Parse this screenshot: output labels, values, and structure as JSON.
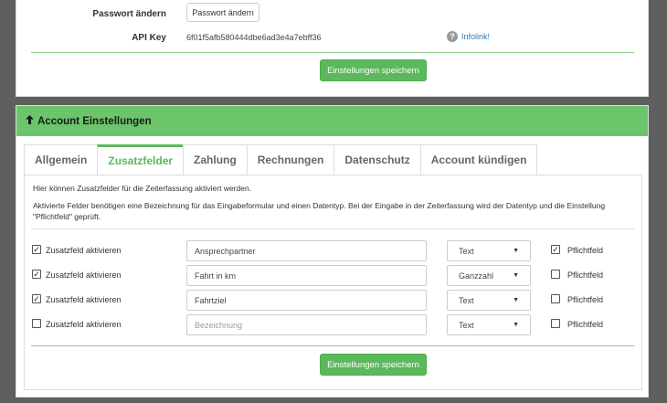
{
  "top_panel": {
    "password_label": "Passwort ändern",
    "password_button": "Passwort ändern",
    "api_key_label": "API Key",
    "api_key_value": "6f01f5afb580444dbe6ad3e4a7ebff36",
    "infolink_label": "Infolink!",
    "question_glyph": "?",
    "save_button": "Einstellungen speichern"
  },
  "account_panel": {
    "heading": "Account Einstellungen",
    "heading_icon_glyph": "🠙",
    "tabs": [
      {
        "label": "Allgemein",
        "active": false
      },
      {
        "label": "Zusatzfelder",
        "active": true
      },
      {
        "label": "Zahlung",
        "active": false
      },
      {
        "label": "Rechnungen",
        "active": false
      },
      {
        "label": "Datenschutz",
        "active": false
      },
      {
        "label": "Account kündigen",
        "active": false
      }
    ],
    "intro_text": "Hier können Zusatzfelder für die Zeiterfassung aktiviert werden.",
    "help_text": "Aktivierte Felder benötigen eine Bezeichnung für das Eingabeformular und einen Datentyp. Bei der Eingabe in der Zeiterfassung wird der Datentyp und die Einstellung \"Pflichtfeld\" geprüft.",
    "activate_label": "Zusatzfeld aktivieren",
    "required_label": "Pflichtfeld",
    "placeholder": "Bezeichnung",
    "caret_glyph": "▼",
    "check_glyph": "✓",
    "fields": [
      {
        "active": true,
        "name": "Ansprechpartner",
        "type": "Text",
        "required": true
      },
      {
        "active": true,
        "name": "Fahrt in km",
        "type": "Ganzzahl",
        "required": false
      },
      {
        "active": true,
        "name": "Fahrtziel",
        "type": "Text",
        "required": false
      },
      {
        "active": false,
        "name": "",
        "type": "Text",
        "required": false
      }
    ],
    "save_button": "Einstellungen speichern"
  },
  "colors": {
    "heading_green": "#6cc56b",
    "button_green": "#5cb85c",
    "background": "#5f5f5f"
  }
}
